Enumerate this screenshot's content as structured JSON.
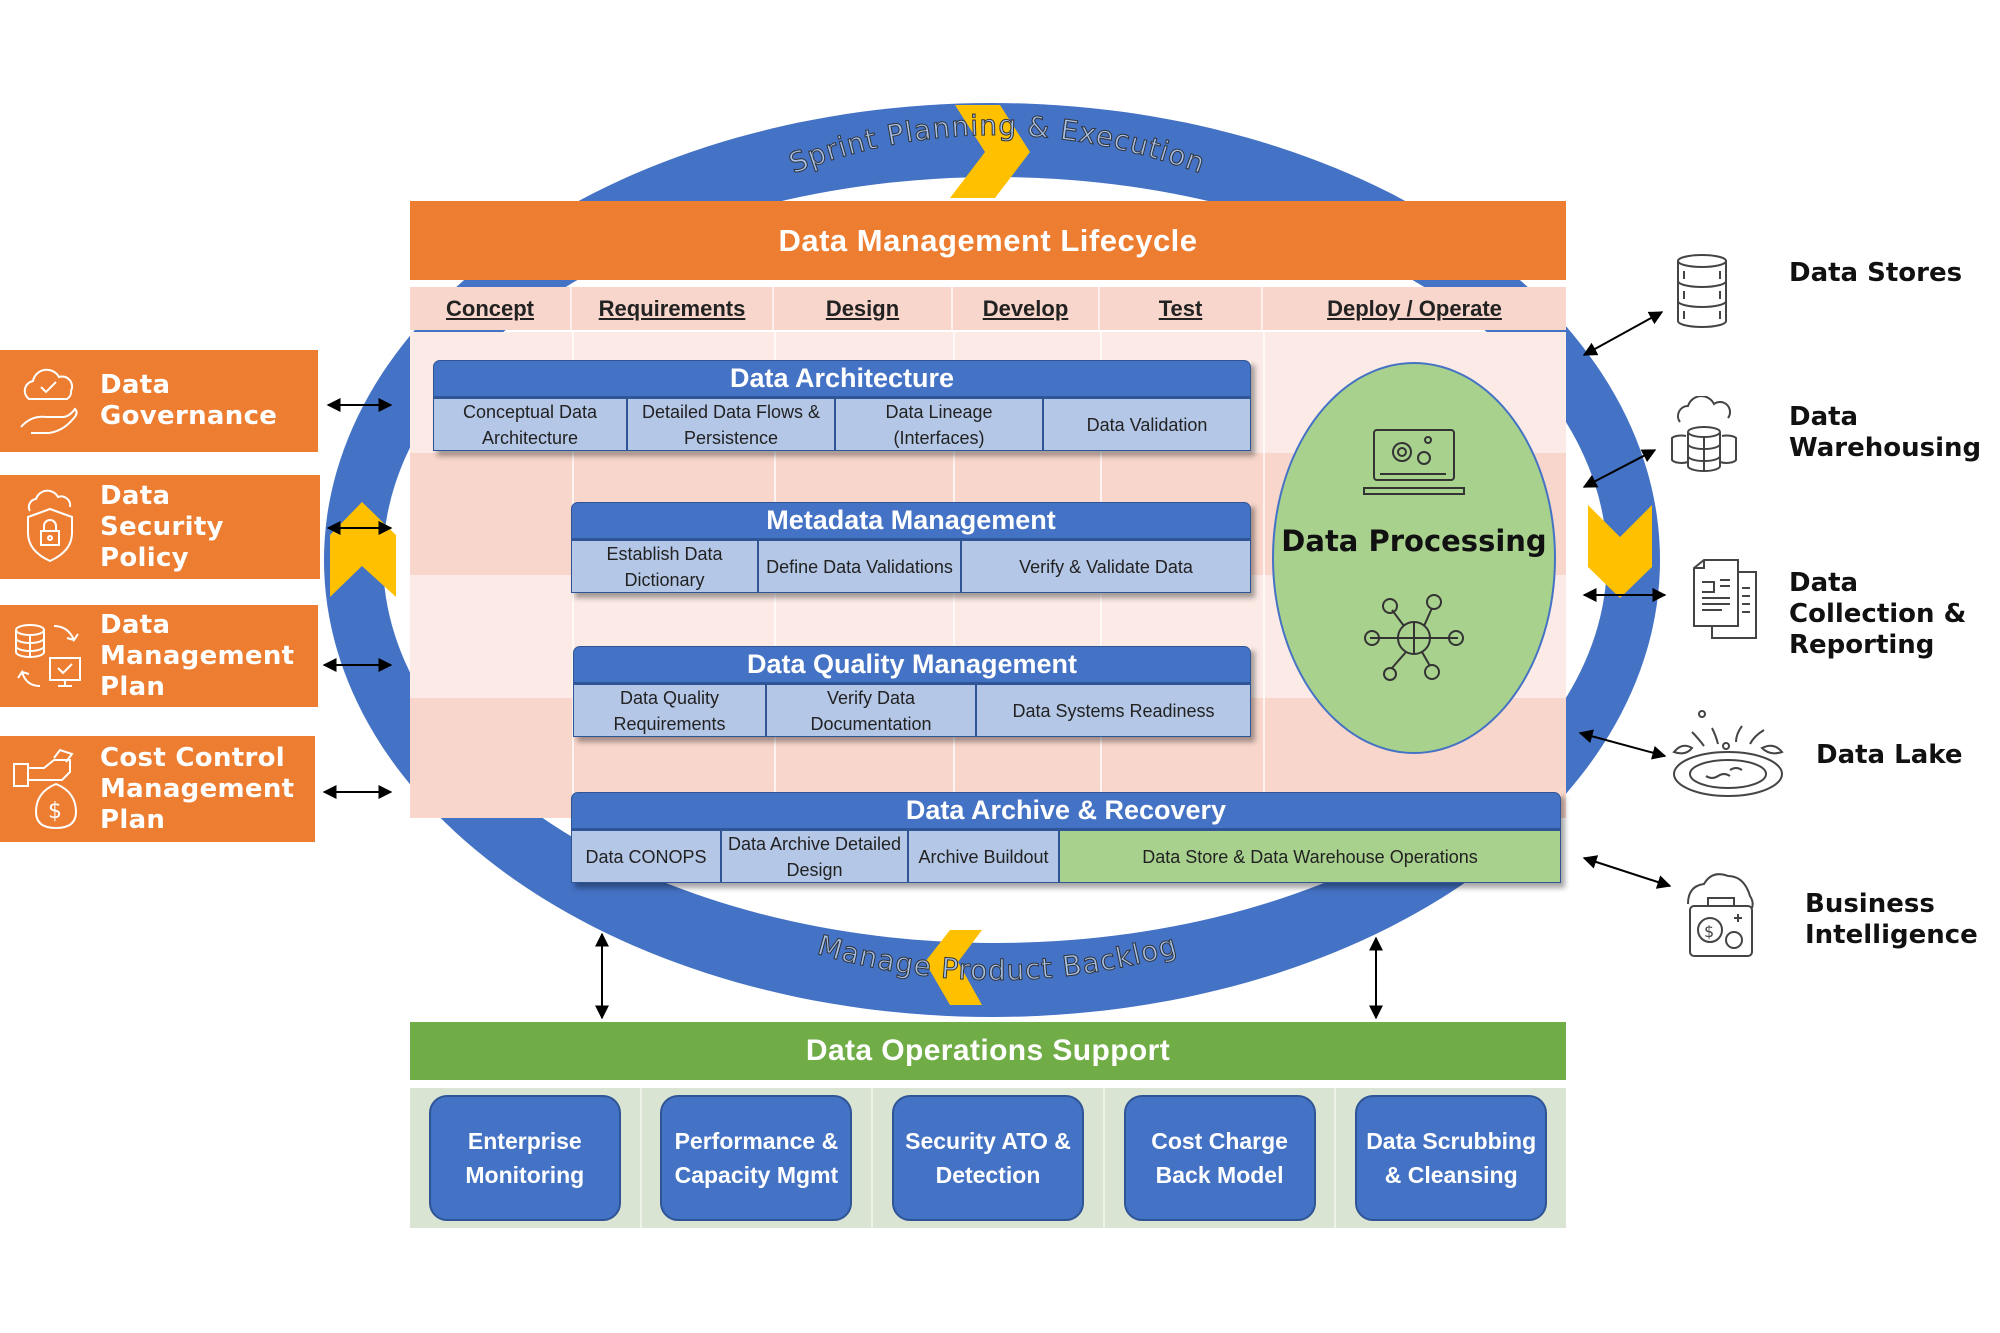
{
  "diagram": {
    "cycle": {
      "top_label": "Sprint Planning & Execution",
      "bottom_label": "Manage Product Backlog"
    },
    "lifecycle": {
      "title": "Data Management Lifecycle",
      "phases": [
        "Concept",
        "Requirements",
        "Design",
        "Develop",
        "Test",
        "Deploy / Operate"
      ],
      "blocks": [
        {
          "title": "Data Architecture",
          "cells": [
            "Conceptual Data Architecture",
            "Detailed Data Flows & Persistence",
            "Data Lineage (Interfaces)",
            "Data Validation"
          ]
        },
        {
          "title": "Metadata Management",
          "cells": [
            "Establish Data Dictionary",
            "Define Data Validations",
            "Verify & Validate Data"
          ]
        },
        {
          "title": "Data Quality Management",
          "cells": [
            "Data Quality Requirements",
            "Verify Data Documentation",
            "Data Systems Readiness"
          ]
        },
        {
          "title": "Data Archive & Recovery",
          "cells": [
            "Data CONOPS",
            "Data Archive Detailed Design",
            "Archive Buildout",
            "Data Store & Data Warehouse Operations"
          ]
        }
      ],
      "processing": {
        "label": "Data Processing",
        "icons": [
          "laptop-gears-icon",
          "network-globe-icon"
        ]
      }
    },
    "left_items": [
      {
        "label": "Data Governance",
        "icon": "cloud-hand-check-icon"
      },
      {
        "label": "Data Security Policy",
        "icon": "shield-lock-cloud-icon"
      },
      {
        "label": "Data Management Plan",
        "icon": "database-monitor-cycle-icon"
      },
      {
        "label": "Cost Control Management Plan",
        "icon": "hand-money-bag-icon"
      }
    ],
    "right_items": [
      {
        "label": "Data Stores",
        "icon": "database-stack-icon"
      },
      {
        "label": "Data Warehousing",
        "icon": "cloud-databases-icon"
      },
      {
        "label": "Data Collection & Reporting",
        "icon": "documents-icon"
      },
      {
        "label": "Data Lake",
        "icon": "lake-splash-icon"
      },
      {
        "label": "Business Intelligence",
        "icon": "briefcase-gears-icon"
      }
    ],
    "operations": {
      "title": "Data Operations Support",
      "tiles": [
        "Enterprise Monitoring",
        "Performance & Capacity Mgmt",
        "Security ATO & Detection",
        "Cost Charge Back Model",
        "Data Scrubbing & Cleansing"
      ]
    },
    "colors": {
      "orange": "#ED7D31",
      "blue": "#4472C4",
      "light_blue": "#B4C7E7",
      "green": "#70AD47",
      "light_green": "#A9D18E",
      "gold": "#FFC000",
      "peach": "#F8D6CB"
    }
  }
}
